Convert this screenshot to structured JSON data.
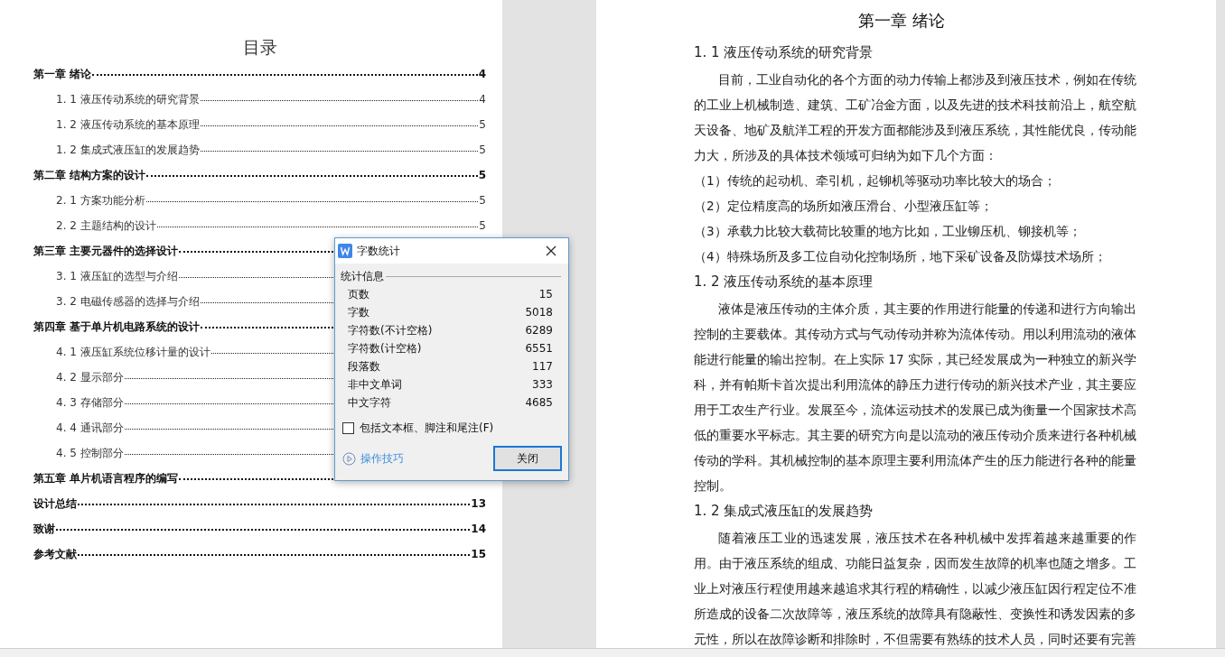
{
  "toc": {
    "title": "目录",
    "entries": [
      {
        "kind": "chapter",
        "text": "第一章  绪论",
        "page": "4"
      },
      {
        "kind": "section",
        "text": "1. 1 液压传动系统的研究背景",
        "page": "4"
      },
      {
        "kind": "section",
        "text": "1. 2 液压传动系统的基本原理",
        "page": "5"
      },
      {
        "kind": "section",
        "text": "1. 2  集成式液压缸的发展趋势",
        "page": "5"
      },
      {
        "kind": "chapter",
        "text": "第二章  结构方案的设计",
        "page": "5"
      },
      {
        "kind": "section",
        "text": "2. 1  方案功能分析",
        "page": "5"
      },
      {
        "kind": "section",
        "text": "2. 2  主题结构的设计",
        "page": "5"
      },
      {
        "kind": "chapter",
        "text": "第三章  主要元器件的选择设计"
      },
      {
        "kind": "section",
        "text": "3. 1  液压缸的选型与介绍"
      },
      {
        "kind": "section",
        "text": "3. 2  电磁传感器的选择与介绍"
      },
      {
        "kind": "chapter",
        "text": "第四章  基于单片机电路系统的设计"
      },
      {
        "kind": "section",
        "text": "4. 1  液压缸系统位移计量的设计"
      },
      {
        "kind": "section",
        "text": "4. 2  显示部分"
      },
      {
        "kind": "section",
        "text": "4. 3  存储部分"
      },
      {
        "kind": "section",
        "text": "4. 4  通讯部分"
      },
      {
        "kind": "section",
        "text": "4. 5  控制部分"
      },
      {
        "kind": "chapter",
        "text": "第五章  单片机语言程序的编写"
      },
      {
        "kind": "chapter",
        "text": "设计总结",
        "page": "13"
      },
      {
        "kind": "chapter",
        "text": "致谢",
        "page": "14"
      },
      {
        "kind": "chapter",
        "text": "参考文献",
        "page": "15"
      }
    ]
  },
  "document": {
    "title": "第一章  绪论",
    "blocks": [
      {
        "kind": "heading",
        "text": "1. 1 液压传动系统的研究背景"
      },
      {
        "kind": "paragraph",
        "text": "目前，工业自动化的各个方面的动力传输上都涉及到液压技术，例如在传统的工业上机械制造、建筑、工矿冶金方面，以及先进的技术科技前沿上，航空航天设备、地矿及航洋工程的开发方面都能涉及到液压系统，其性能优良，传动能力大，所涉及的具体技术领域可归纳为如下几个方面："
      },
      {
        "kind": "list_item",
        "text": "（1）传统的起动机、牵引机，起铆机等驱动功率比较大的场合；"
      },
      {
        "kind": "list_item",
        "text": "（2）定位精度高的场所如液压滑台、小型液压缸等；"
      },
      {
        "kind": "list_item",
        "text": "（3）承载力比较大载荷比较重的地方比如，工业铆压机、铆接机等；"
      },
      {
        "kind": "list_item",
        "text": "（4）特殊场所及多工位自动化控制场所，地下采矿设备及防爆技术场所；"
      },
      {
        "kind": "heading",
        "text": "1. 2 液压传动系统的基本原理"
      },
      {
        "kind": "paragraph",
        "text": "液体是液压传动的主体介质，其主要的作用进行能量的传递和进行方向输出控制的主要载体。其传动方式与气动传动并称为流体传动。用以利用流动的液体能进行能量的输出控制。在上实际 17 实际，其已经发展成为一种独立的新兴学科，并有帕斯卡首次提出利用流体的静压力进行传动的新兴技术产业，其主要应用于工农生产行业。发展至今，流体运动技术的发展已成为衡量一个国家技术高低的重要水平标志。其主要的研究方向是以流动的液压传动介质来进行各种机械传动的学科。其机械控制的基本原理主要利用流体产生的压力能进行各种的能量控制。"
      },
      {
        "kind": "heading",
        "text": "1. 2  集成式液压缸的发展趋势"
      },
      {
        "kind": "paragraph",
        "text": "随着液压工业的迅速发展，液压技术在各种机械中发挥着越来越重要的作用。由于液压系统的组成、功能日益复杂，因而发生故障的机率也随之增多。工业上对液压行程使用越来越追求其行程的精确性，以减少液压缸因行程定位不准所造成的设备二次故障等，液压系统的故障具有隐蔽性、变换性和诱发因素的多元性，所以在故障诊断和排除时，不但需要有熟练的技术人员，同时还要有完善"
      }
    ]
  },
  "dialog": {
    "title": "字数统计",
    "group": "统计信息",
    "stats": [
      {
        "label": "页数",
        "value": "15"
      },
      {
        "label": "字数",
        "value": "5018"
      },
      {
        "label": "字符数(不计空格)",
        "value": "6289"
      },
      {
        "label": "字符数(计空格)",
        "value": "6551"
      },
      {
        "label": "段落数",
        "value": "117"
      },
      {
        "label": "非中文单词",
        "value": "333"
      },
      {
        "label": "中文字符",
        "value": "4685"
      }
    ],
    "option": {
      "label": "包括文本框、脚注和尾注(F)",
      "checked": false
    },
    "tips_link": "操作技巧",
    "close_button": "关闭"
  }
}
